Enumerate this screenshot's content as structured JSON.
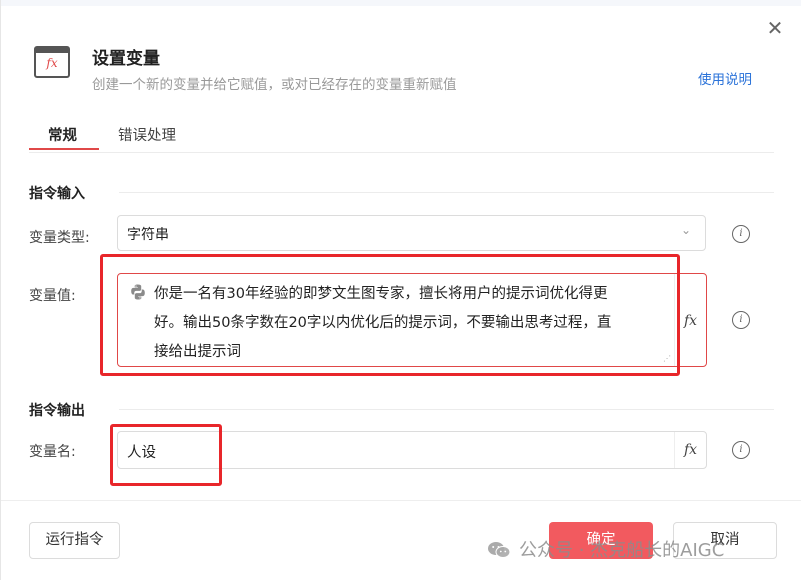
{
  "dialog": {
    "title": "设置变量",
    "subtitle": "创建一个新的变量并给它赋值，或对已经存在的变量重新赋值",
    "help_link": "使用说明",
    "icon": "function-fx-icon",
    "close_icon": "close-icon"
  },
  "tabs": [
    {
      "label": "常规",
      "active": true
    },
    {
      "label": "错误处理",
      "active": false
    }
  ],
  "input_section": {
    "title": "指令输入",
    "var_type": {
      "label": "变量类型:",
      "value": "字符串"
    },
    "var_value": {
      "label": "变量值:",
      "value": "你是一名有30年经验的即梦文生图专家，擅长将用户的提示词优化得更好。输出50条字数在20字以内优化后的提示词，不要输出思考过程，直接给出提示词",
      "lines": [
        "你是一名有30年经验的即梦文生图专家，擅长将用户的提示词优化得更",
        "好。输出50条字数在20字以内优化后的提示词，不要输出思考过程，直",
        "接给出提示词"
      ]
    }
  },
  "output_section": {
    "title": "指令输出",
    "var_name": {
      "label": "变量名:",
      "value": "人设"
    }
  },
  "footer": {
    "run_label": "运行指令",
    "ok_label": "确定",
    "cancel_label": "取消"
  },
  "watermark": "公众号 · 杰克船长的AIGC",
  "colors": {
    "accent": "#e04848",
    "link": "#2b73d9",
    "ok_button": "#f25a5f",
    "highlight_box": "#e8262a"
  }
}
